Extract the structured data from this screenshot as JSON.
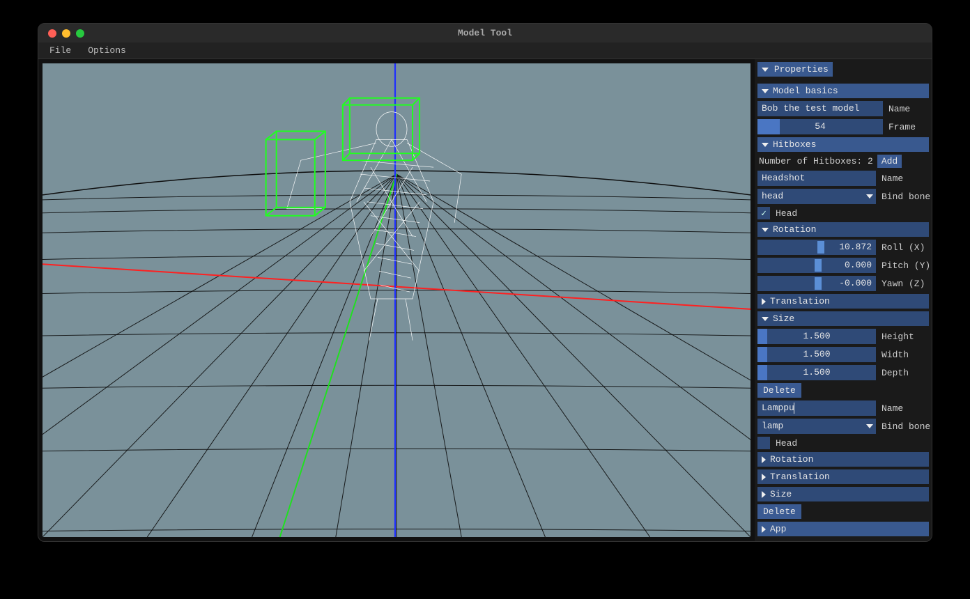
{
  "window": {
    "title": "Model Tool"
  },
  "menubar": {
    "file": "File",
    "options": "Options"
  },
  "panel": {
    "tab": "Properties",
    "model_basics": {
      "header": "Model basics",
      "name_value": "Bob the test model",
      "name_label": "Name",
      "frame_value": "54",
      "frame_label": "Frame"
    },
    "hitboxes": {
      "header": "Hitboxes",
      "count_text": "Number of Hitboxes: 2",
      "add_btn": "Add",
      "h1": {
        "name_value": "Headshot",
        "name_label": "Name",
        "bind_value": "head",
        "bind_label": "Bind bone",
        "head_label": "Head",
        "head_checked": true,
        "rotation": {
          "header": "Rotation",
          "roll_value": "10.872",
          "roll_label": "Roll (X)",
          "pitch_value": "0.000",
          "pitch_label": "Pitch (Y)",
          "yaw_value": "-0.000",
          "yaw_label": "Yawn (Z)"
        },
        "translation_header": "Translation",
        "size": {
          "header": "Size",
          "height_value": "1.500",
          "height_label": "Height",
          "width_value": "1.500",
          "width_label": "Width",
          "depth_value": "1.500",
          "depth_label": "Depth"
        },
        "delete_btn": "Delete"
      },
      "h2": {
        "name_value": "Lamppu",
        "name_label": "Name",
        "bind_value": "lamp",
        "bind_label": "Bind bone",
        "head_label": "Head",
        "head_checked": false,
        "rotation_header": "Rotation",
        "translation_header": "Translation",
        "size_header": "Size",
        "delete_btn": "Delete"
      }
    },
    "app_header": "App"
  }
}
